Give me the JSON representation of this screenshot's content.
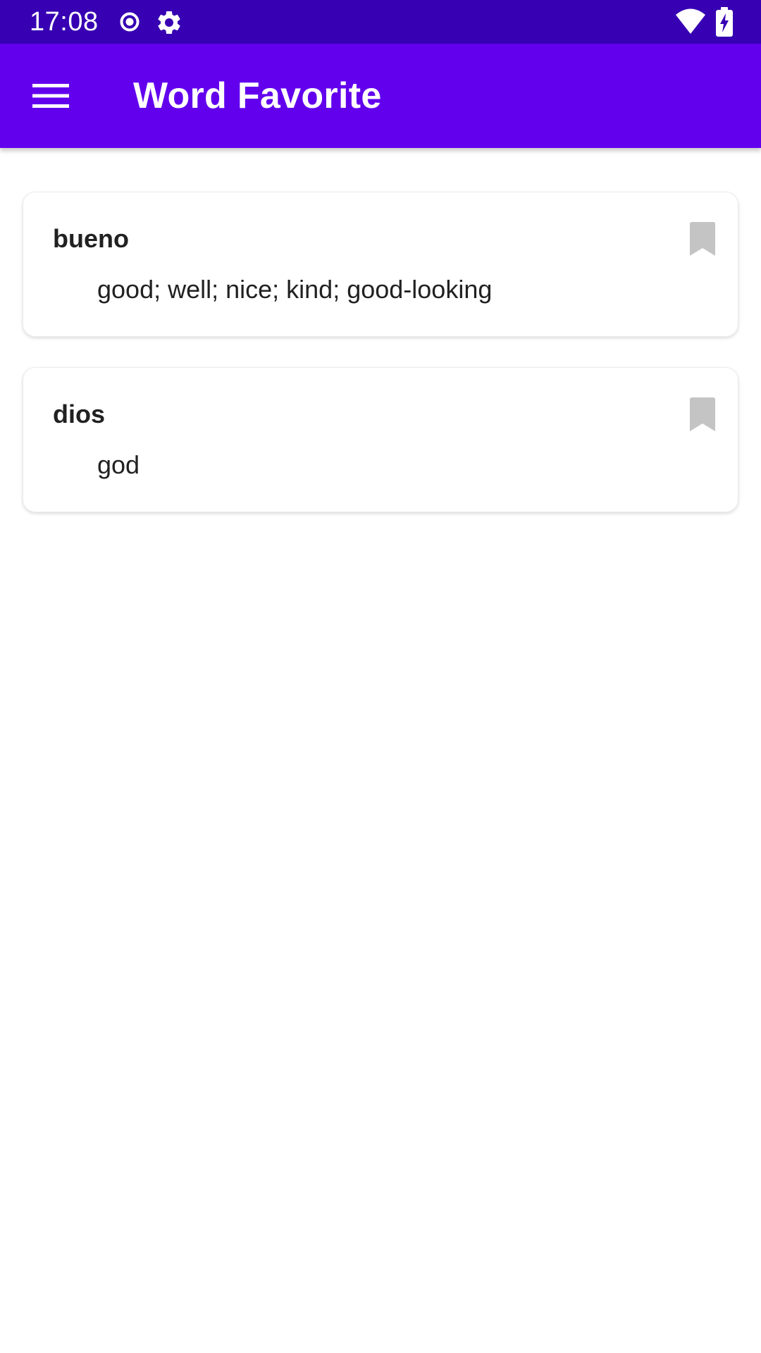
{
  "status_bar": {
    "time": "17:08",
    "icons": [
      "record-icon",
      "settings-gear-icon",
      "wifi-icon",
      "battery-charging-icon"
    ]
  },
  "app_bar": {
    "title": "Word Favorite",
    "menu_icon": "hamburger-menu-icon"
  },
  "favorites": [
    {
      "word": "bueno",
      "meaning": "good; well; nice; kind; good-looking",
      "bookmark_icon": "bookmark-icon"
    },
    {
      "word": "dios",
      "meaning": "god",
      "bookmark_icon": "bookmark-icon"
    }
  ],
  "colors": {
    "status_bar": "#3700B3",
    "app_bar": "#6200EE",
    "bookmark": "#C4C4C4",
    "text": "#212121"
  }
}
